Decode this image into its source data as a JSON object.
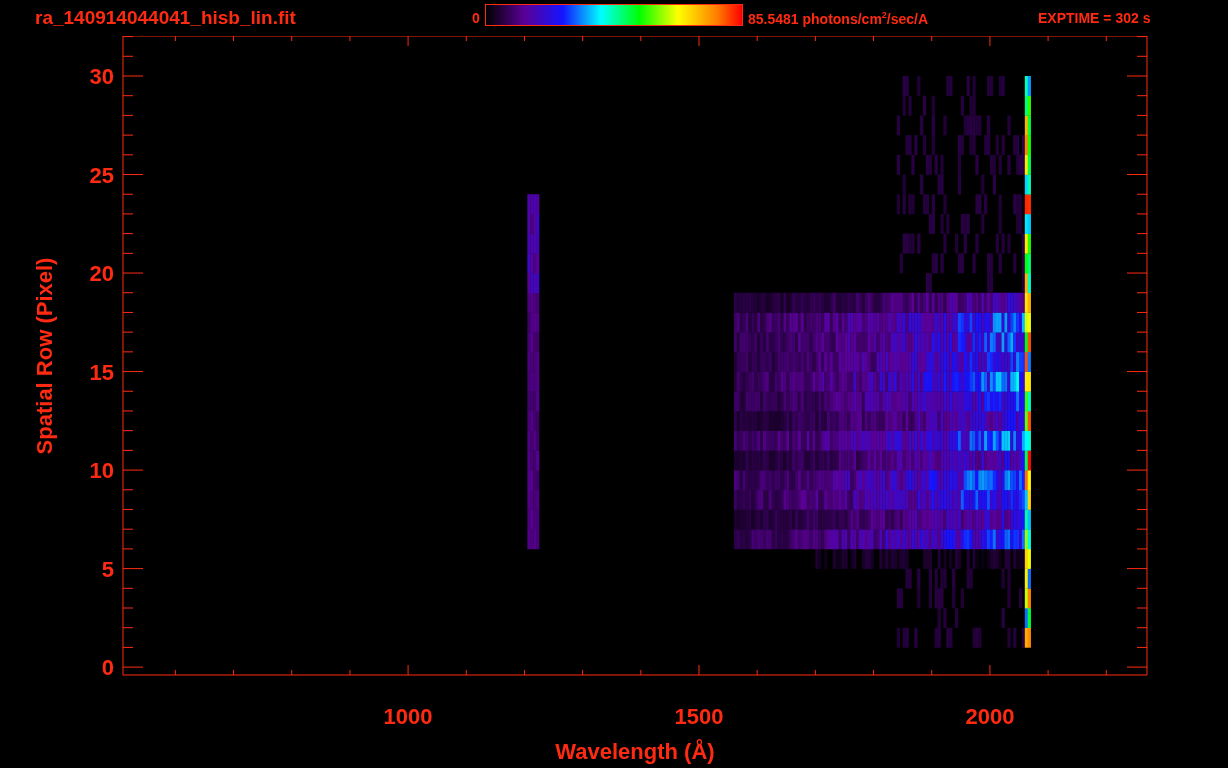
{
  "header": {
    "filename": "ra_140914044041_hisb_lin.fit",
    "colorbar": {
      "min_label": "0",
      "max_label": "85.5481 photons/cm$^{2}$/sec/A"
    },
    "exposure": "EXPTIME = 302 s"
  },
  "plot": {
    "xlabel": "Wavelength (Å)",
    "ylabel": "Spatial Row (Pixel)",
    "xtick_labels": [
      "1000",
      "1500",
      "2000"
    ],
    "ytick_labels": [
      "30",
      "25",
      "20",
      "15",
      "10",
      "5",
      "0"
    ]
  }
}
